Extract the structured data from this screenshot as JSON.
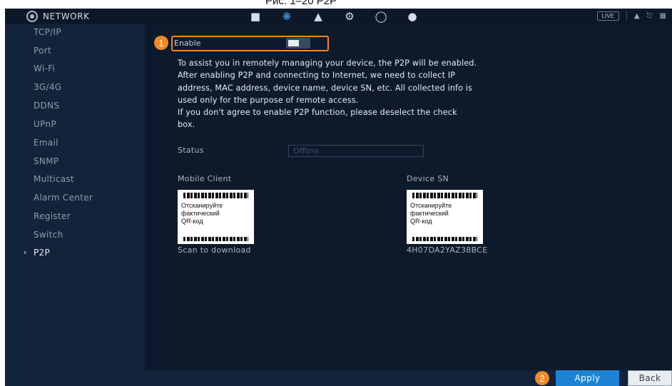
{
  "caption": "Рис. 1–20 P2P",
  "header": {
    "title": "NETWORK",
    "live_label": "LIVE",
    "icons": [
      "camera-icon",
      "network-icon",
      "storage-icon",
      "system-settings-icon",
      "security-icon",
      "account-icon"
    ]
  },
  "sidebar": {
    "items": [
      {
        "label": "TCP/IP"
      },
      {
        "label": "Port"
      },
      {
        "label": "Wi-Fi"
      },
      {
        "label": "3G/4G"
      },
      {
        "label": "DDNS"
      },
      {
        "label": "UPnP"
      },
      {
        "label": "Email"
      },
      {
        "label": "SNMP"
      },
      {
        "label": "Multicast"
      },
      {
        "label": "Alarm Center"
      },
      {
        "label": "Register"
      },
      {
        "label": "Switch"
      },
      {
        "label": "P2P",
        "active": true
      }
    ]
  },
  "main": {
    "callout_1": "1",
    "callout_2": "2",
    "enable_label": "Enable",
    "notice_lines": [
      "To assist you in remotely managing your device, the P2P will be enabled.",
      " After enabling P2P and connecting to Internet, we need to collect IP",
      "address, MAC address, device name, device SN, etc. All collected info is",
      "used only for the purpose of remote access.",
      "If you don't agree to enable P2P function, please deselect the check",
      "box."
    ],
    "status_label": "Status",
    "status_value": "Offline",
    "mobile_client_label": "Mobile Client",
    "device_sn_label": "Device SN",
    "qr_placeholder": "Отсканируйте\nфактический\nQR-код",
    "scan_label": "Scan to download",
    "device_sn_value": "4H07DA2YAZ38BCE"
  },
  "footer": {
    "apply_label": "Apply",
    "back_label": "Back"
  },
  "colors": {
    "accent": "#1d84d4",
    "callout": "#f08a24",
    "background": "#0d1a2b"
  }
}
